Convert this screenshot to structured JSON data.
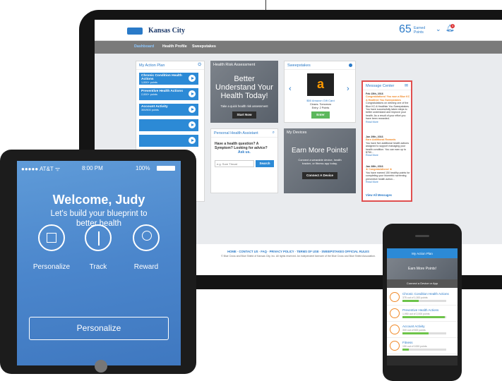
{
  "laptop": {
    "brand": "Kansas City",
    "points": {
      "value": "65",
      "label": "Earned Points"
    },
    "badge_count": "3",
    "nav": [
      "Dashboard",
      "Health Profile",
      "Sweepstakes"
    ],
    "action_plan": {
      "title": "My Action Plan",
      "items": [
        {
          "label": "Chronic Condition Health Actions",
          "sub": "1,000+ points"
        },
        {
          "label": "Preventive Health Actions",
          "sub": "2,000+ points"
        },
        {
          "label": "Account Activity",
          "sub": "300/500 points"
        }
      ]
    },
    "hra": {
      "title": "Health Risk Assessment",
      "headline": "Better Understand Your Health Today!",
      "sub": "Take a quick health risk assessment",
      "button": "Start Now"
    },
    "sweepstakes": {
      "title": "Sweepstakes",
      "prize": "$50 Amazon Gift Card",
      "closes": "Closes: Tomorrow",
      "entry": "Entry: 2 Points",
      "button": "Enter"
    },
    "pha": {
      "title": "Personal Health Assistant",
      "question": "Have a health question? A Symptom? Looking for advice?",
      "link": "Ask us.",
      "placeholder": "e.g. Sore Throat",
      "button": "Search"
    },
    "devices": {
      "title": "My Devices",
      "headline": "Earn More Points!",
      "sub": "Connect a wearable device, health tracker, or fitness app today.",
      "button": "Connect A Device"
    },
    "messages": {
      "title": "Message Center",
      "items": [
        {
          "date": "Feb 15th, 2016",
          "headline": "Congratulations! You won a Blue KC A Healthier You Sweepstakes",
          "body": "Congratulations on winning one of the Blue KC A Healthier You Sweepstakes. You have successfully taken steps to better understand and improve your health. As a result of your effort you have been rewarded.",
          "more": "Read More"
        },
        {
          "date": "Jan 29th, 2016",
          "headline": "Earn Additional Rewards",
          "body": "You have five additional health actions assigned to support managing your health condition. You can earn up to $750...",
          "more": "Read More"
        },
        {
          "date": "Jan 28th, 2016",
          "headline": "★ Congratulations! ★",
          "body": "You have earned 150 healthy points for completing your biometric screening preventive health action...",
          "more": "Read More"
        }
      ],
      "view_all": "View All Messages"
    },
    "footer": {
      "links": "HOME · CONTACT US · FAQ · PRIVACY POLICY · TERMS OF USE · SWEEPSTAKES OFFICIAL RULES",
      "legal": "© Blue Cross and Blue Shield of Kansas City, Inc. All rights reserved. An independent licensee of the Blue Cross and Blue Shield Association."
    }
  },
  "tablet": {
    "carrier": "●●●●● AT&T ᯤ",
    "time": "8:00 PM",
    "battery": "100%",
    "welcome": "Welcome, Judy",
    "tagline": "Let's build your blueprint to better health",
    "steps": [
      "Personalize",
      "Track",
      "Reward"
    ],
    "button": "Personalize"
  },
  "phone": {
    "header": "My Action Plan",
    "banner_title": "Earn More Points!",
    "connect": "Connect a Device or App",
    "items": [
      {
        "title": "Chronic Condition Health Actions",
        "sub": "375 out of 1,000 points",
        "progress": 0.37
      },
      {
        "title": "Preventive Health Actions",
        "sub": "1,950 out of 2,000 points",
        "progress": 0.97
      },
      {
        "title": "Account Activity",
        "sub": "300 out of 500 points",
        "progress": 0.6
      },
      {
        "title": "Fitness",
        "sub": "150 out of 1000 points",
        "progress": 0.15
      }
    ]
  }
}
